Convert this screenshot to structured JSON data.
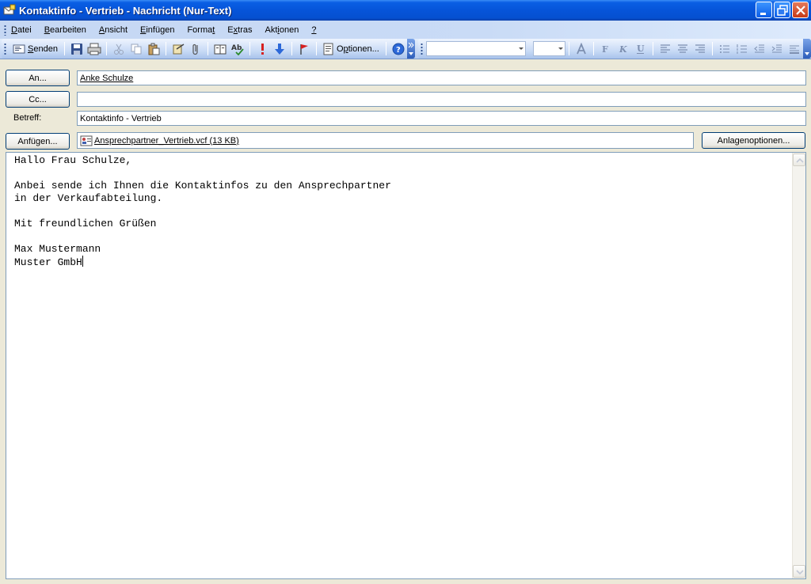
{
  "window": {
    "title": "Kontaktinfo - Vertrieb - Nachricht (Nur-Text)"
  },
  "menubar": {
    "items": [
      {
        "label_pre": "",
        "label_key": "D",
        "label_post": "atei"
      },
      {
        "label_pre": "",
        "label_key": "B",
        "label_post": "earbeiten"
      },
      {
        "label_pre": "",
        "label_key": "A",
        "label_post": "nsicht"
      },
      {
        "label_pre": "",
        "label_key": "E",
        "label_post": "infügen"
      },
      {
        "label_pre": "Forma",
        "label_key": "t",
        "label_post": ""
      },
      {
        "label_pre": "E",
        "label_key": "x",
        "label_post": "tras"
      },
      {
        "label_pre": "Akt",
        "label_key": "i",
        "label_post": "onen"
      },
      {
        "label_pre": "",
        "label_key": "?",
        "label_post": ""
      }
    ]
  },
  "toolbar": {
    "send_label_pre": "",
    "send_label_key": "S",
    "send_label_post": "enden",
    "options_label_pre": "O",
    "options_label_key": "p",
    "options_label_post": "tionen...",
    "font_name": "",
    "font_size": ""
  },
  "header": {
    "to_button": "An...",
    "to_value": "Anke Schulze",
    "cc_button": "Cc...",
    "cc_value": "",
    "subject_label": "Betreff:",
    "subject_value": "Kontaktinfo - Vertrieb",
    "attach_button": "Anfügen...",
    "attachment_name": "Ansprechpartner_Vertrieb.vcf (13 KB)",
    "attach_options_button": "Anlagenoptionen..."
  },
  "body": {
    "text": "Hallo Frau Schulze,\n\nAnbei sende ich Ihnen die Kontaktinfos zu den Ansprechpartner\nin der Verkaufabteilung.\n\nMit freundlichen Grüßen\n\nMax Mustermann\nMuster GmbH"
  },
  "colors": {
    "titlebar": "#0654d9",
    "menubar": "#c5d7f3",
    "window_bg": "#ece9d8"
  }
}
